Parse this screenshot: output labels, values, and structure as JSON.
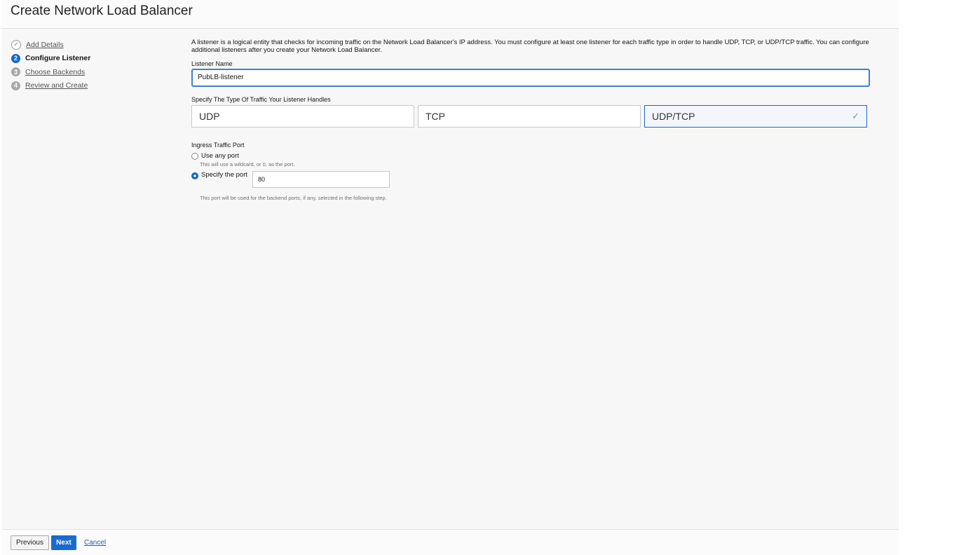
{
  "header": {
    "title": "Create Network Load Balancer"
  },
  "steps": [
    {
      "num": "✓",
      "label": "Add Details",
      "state": "done"
    },
    {
      "num": "2",
      "label": "Configure Listener",
      "state": "active"
    },
    {
      "num": "3",
      "label": "Choose Backends",
      "state": "pending"
    },
    {
      "num": "4",
      "label": "Review and Create",
      "state": "pending"
    }
  ],
  "main": {
    "description": "A listener is a logical entity that checks for incoming traffic on the Network Load Balancer's IP address. You must configure at least one listener for each traffic type in order to handle UDP, TCP, or UDP/TCP traffic. You can configure additional listeners after you create your Network Load Balancer.",
    "listener_name_label": "Listener Name",
    "listener_name_value": "PubLB-listener",
    "traffic_label": "Specify The Type Of Traffic Your Listener Handles",
    "traffic_options": [
      "UDP",
      "TCP",
      "UDP/TCP"
    ],
    "traffic_selected": "UDP/TCP",
    "ingress_label": "Ingress Traffic Port",
    "any_port_label": "Use any port",
    "any_port_hint": "This will use a wildcard, or 0, as the port.",
    "specify_port_label": "Specify the port",
    "port_value": "80",
    "port_hint": "This port will be used for the backend ports, if any, selected in the following step."
  },
  "footer": {
    "previous": "Previous",
    "next": "Next",
    "cancel": "Cancel"
  },
  "colors": {
    "accent": "#1a6ad1"
  }
}
